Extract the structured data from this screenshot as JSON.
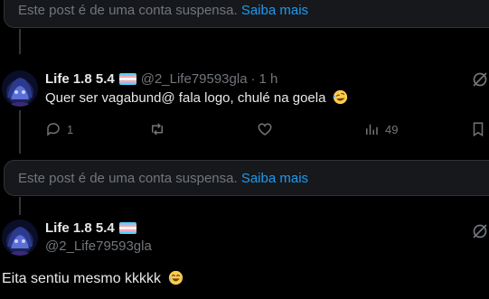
{
  "suspended_notice_1": {
    "text": "Este post é de uma conta suspensa.",
    "link": "Saiba mais"
  },
  "tweet_1": {
    "display_name": "Life 1.8 5.4",
    "handle": "@2_Life79593gla",
    "separator": "·",
    "time": "1 h",
    "text": "Quer ser vagabund@ fala logo, chulé na goela",
    "emoji_icon": "rolling-on-floor-laughing-emoji",
    "reply_count": "1",
    "repost_count": "",
    "like_count": "",
    "view_count": "49"
  },
  "suspended_notice_2": {
    "text": "Este post é de uma conta suspensa.",
    "link": "Saiba mais"
  },
  "tweet_2": {
    "display_name": "Life 1.8 5.4",
    "handle": "@2_Life79593gla",
    "text": "Eita sentiu mesmo kkkkk",
    "emoji_icon": "tears-of-joy-emoji"
  },
  "colors": {
    "background": "#000000",
    "text_primary": "#e7e9ea",
    "text_secondary": "#71767b",
    "link": "#1d9bf0",
    "card_background": "#16181c",
    "border": "#2f3336"
  }
}
